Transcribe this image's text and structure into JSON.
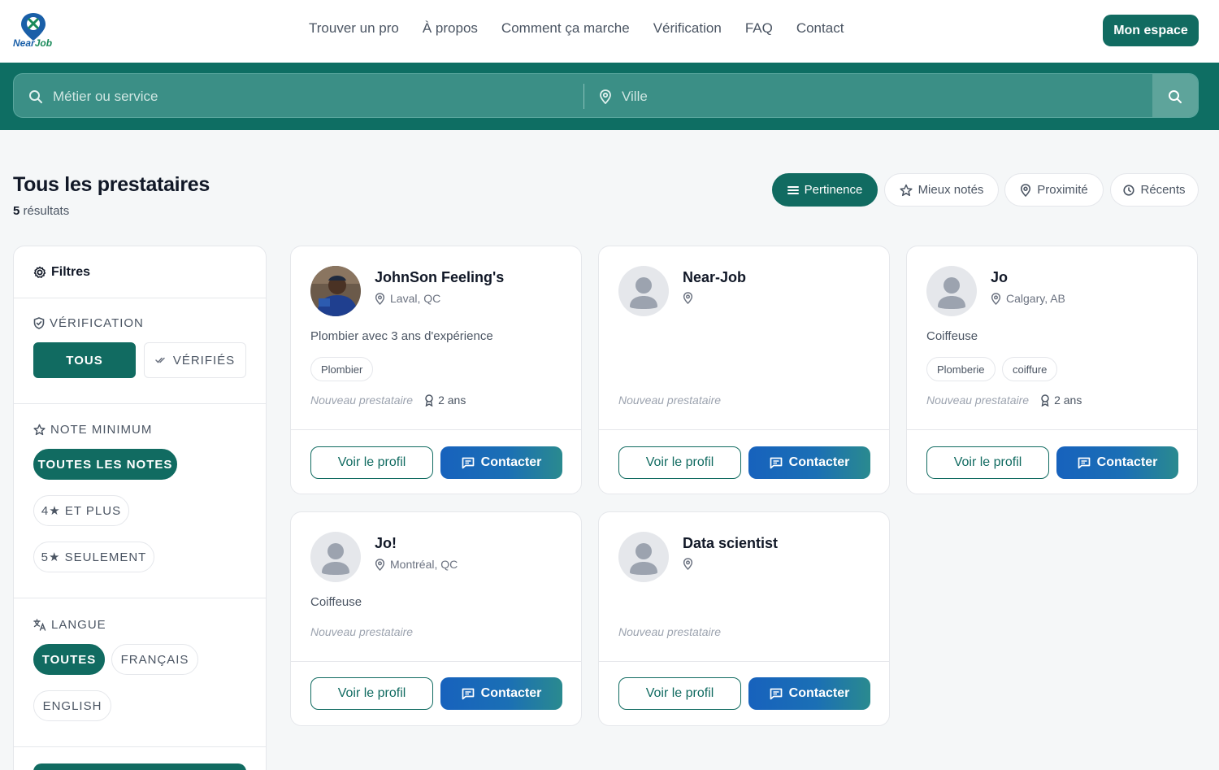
{
  "header": {
    "logo_text_a": "Near",
    "logo_text_b": "Job",
    "nav": [
      "Trouver un pro",
      "À propos",
      "Comment ça marche",
      "Vérification",
      "FAQ",
      "Contact"
    ],
    "cta": "Mon espace"
  },
  "search": {
    "job_placeholder": "Métier ou service",
    "city_placeholder": "Ville"
  },
  "list": {
    "title": "Tous les prestataires",
    "count": "5",
    "count_label": "résultats"
  },
  "sort": {
    "options": [
      "Pertinence",
      "Mieux notés",
      "Proximité",
      "Récents"
    ],
    "selected": "Pertinence"
  },
  "filters": {
    "title": "Filtres",
    "verification": {
      "label": "Vérification",
      "options": [
        "Tous",
        "Vérifiés"
      ],
      "selected": "Tous"
    },
    "rating": {
      "label": "Note minimum",
      "options": [
        "Toutes les notes",
        "4★ et plus",
        "5★ seulement"
      ],
      "selected": "Toutes les notes"
    },
    "language": {
      "label": "Langue",
      "options": [
        "Toutes",
        "Français",
        "English"
      ],
      "selected": "Toutes"
    }
  },
  "cards": [
    {
      "name": "JohnSon Feeling's",
      "location": "Laval, QC",
      "description": "Plombier avec 3 ans d'expérience",
      "tags": [
        "Plombier"
      ],
      "status": "Nouveau prestataire",
      "experience": "2 ans",
      "has_photo": true
    },
    {
      "name": "Near-Job",
      "location": "",
      "description": "",
      "tags": [],
      "status": "Nouveau prestataire",
      "experience": "",
      "has_photo": false
    },
    {
      "name": "Jo",
      "location": "Calgary, AB",
      "description": "Coiffeuse",
      "tags": [
        "Plomberie",
        "coiffure"
      ],
      "status": "Nouveau prestataire",
      "experience": "2 ans",
      "has_photo": false
    },
    {
      "name": "Jo!",
      "location": "Montréal, QC",
      "description": "Coiffeuse",
      "tags": [],
      "status": "Nouveau prestataire",
      "experience": "",
      "has_photo": false
    },
    {
      "name": "Data scientist",
      "location": "",
      "description": "",
      "tags": [],
      "status": "Nouveau prestataire",
      "experience": "",
      "has_photo": false
    }
  ],
  "card_actions": {
    "profile": "Voir le profil",
    "contact": "Contacter"
  },
  "colors": {
    "primary": "#116b61",
    "contact_blue": "#1762bd",
    "band": "#0e6e63"
  }
}
